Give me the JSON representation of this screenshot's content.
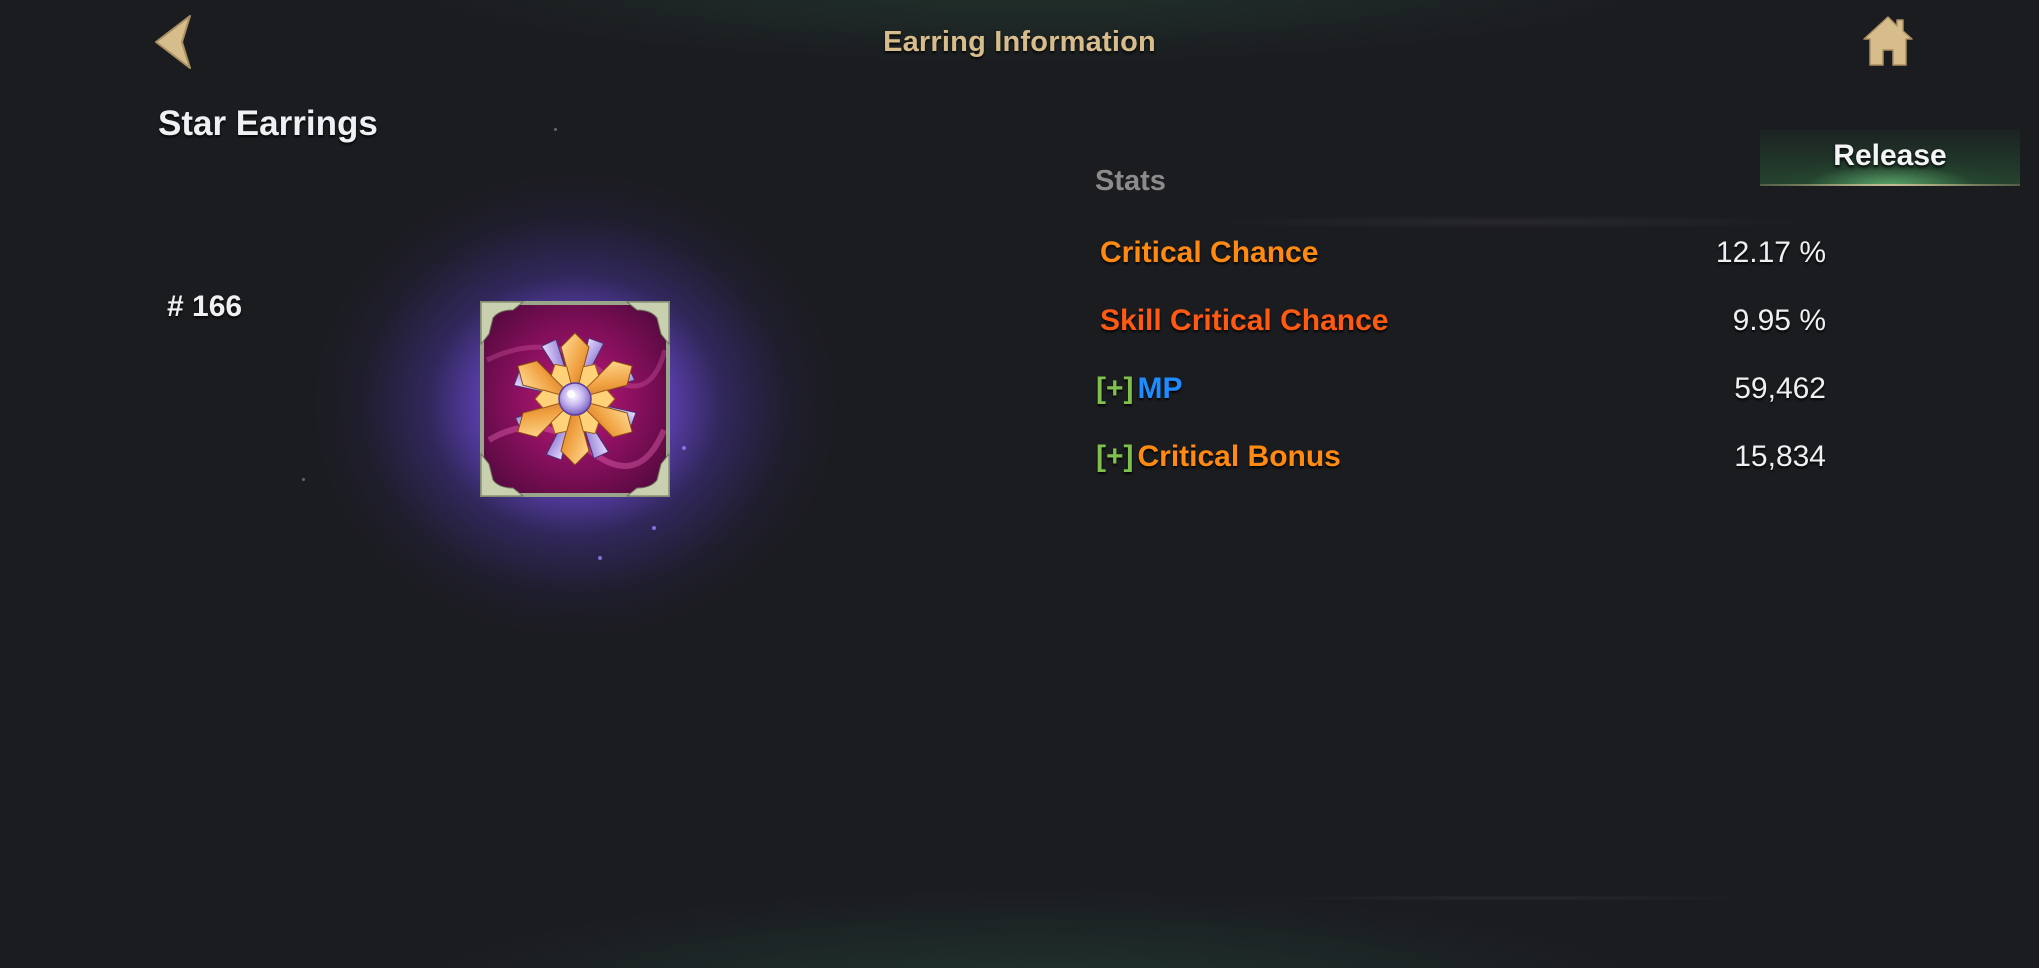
{
  "header": {
    "title": "Earring Information",
    "back_icon": "back-arrow-icon",
    "home_icon": "home-icon"
  },
  "item": {
    "name": "Star Earrings",
    "number": "# 166",
    "icon": "star-earring-icon",
    "glow_color": "#8c5fff"
  },
  "stats": {
    "header": "Stats",
    "release_label": "Release",
    "rows": [
      {
        "prefix": "",
        "label": "Critical Chance",
        "value": "12.17 %",
        "color": "#ff8a12"
      },
      {
        "prefix": "",
        "label": "Skill Critical Chance",
        "value": "9.95 %",
        "color": "#ff5a12"
      },
      {
        "prefix": "[+]",
        "label": "MP",
        "value": "59,462",
        "color": "#1e8cff"
      },
      {
        "prefix": "[+]",
        "label": "Critical Bonus",
        "value": "15,834",
        "color": "#ff8a12"
      }
    ]
  },
  "colors": {
    "title": "#d8bd8c",
    "plus_prefix": "#7fbf4e",
    "background": "#1b1c20"
  }
}
